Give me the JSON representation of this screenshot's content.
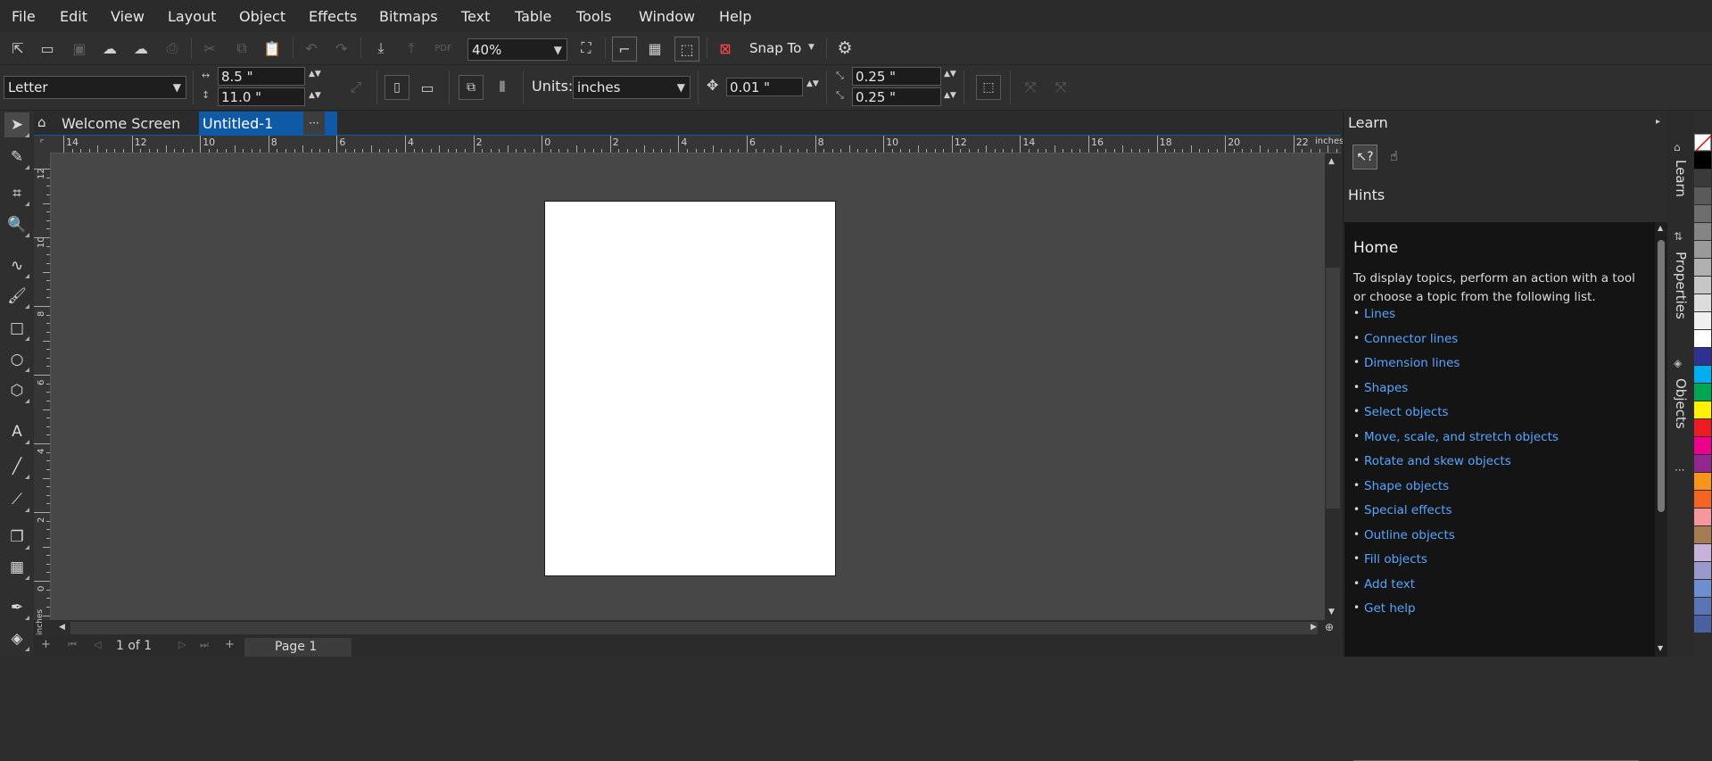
{
  "menu": [
    "File",
    "Edit",
    "View",
    "Layout",
    "Object",
    "Effects",
    "Bitmaps",
    "Text",
    "Table",
    "Tools",
    "Window",
    "Help"
  ],
  "standard_toolbar": {
    "zoom_level": "40%",
    "snap_to_label": "Snap To",
    "icons": [
      "new-document-icon",
      "open-icon",
      "save-icon",
      "cloud-download-icon",
      "cloud-upload-icon",
      "print-icon",
      "cut-icon",
      "copy-icon",
      "paste-icon",
      "undo-icon",
      "redo-icon",
      "import-icon",
      "export-icon",
      "publish-pdf-icon",
      "full-screen-preview-icon",
      "show-rulers-icon",
      "show-grid-icon",
      "show-guidelines-icon",
      "snap-off-icon",
      "options-gear-icon"
    ]
  },
  "property_bar": {
    "page_size": "Letter",
    "width": "8.5 \"",
    "height": "11.0 \"",
    "units_label": "Units:",
    "units_value": "inches",
    "nudge": "0.01 \"",
    "dup_x": "0.25 \"",
    "dup_y": "0.25 \""
  },
  "tabs": {
    "welcome": "Welcome Screen",
    "document": "Untitled-1",
    "more": "···"
  },
  "ruler": {
    "unit": "inches",
    "h_numbers": [
      "14",
      "12",
      "10",
      "8",
      "6",
      "4",
      "2",
      "0",
      "2",
      "4",
      "6",
      "8",
      "10",
      "12",
      "14",
      "16",
      "18",
      "20",
      "22"
    ],
    "v_numbers": [
      "12",
      "10",
      "8",
      "6",
      "4",
      "2",
      "0"
    ]
  },
  "status": {
    "page_counter": "1 of 1",
    "page_tab": "Page 1"
  },
  "docker": {
    "title": "Learn",
    "hints_label": "Hints",
    "home_title": "Home",
    "intro": "To display topics, perform an action with a tool or choose a topic from the following list.",
    "topics": [
      "Lines",
      "Connector lines",
      "Dimension lines",
      "Shapes",
      "Select objects",
      "Move, scale, and stretch objects",
      "Rotate and skew objects",
      "Shape objects",
      "Special effects",
      "Outline objects",
      "Fill objects",
      "Add text",
      "Get help"
    ]
  },
  "side_tabs": [
    "Learn",
    "Properties",
    "Objects"
  ],
  "colors": {
    "accent": "#0e5aa7",
    "link": "#57a5ff",
    "palette": [
      "#ffffff",
      "#000000",
      "#3a3a3a",
      "#5a5a5a",
      "#6e6e6e",
      "#858585",
      "#9a9a9a",
      "#b0b0b0",
      "#c6c6c6",
      "#dcdcdc",
      "#f0f0f0",
      "#ffffff",
      "#2e3192",
      "#00aeef",
      "#00a651",
      "#fff200",
      "#ed1c24",
      "#ec008c",
      "#92278f",
      "#f7941d",
      "#f26522",
      "#f5989d",
      "#a67c52",
      "#c7b2dc",
      "#9999cc",
      "#6d8fd0",
      "#5b74b5",
      "#4a60a0"
    ]
  }
}
